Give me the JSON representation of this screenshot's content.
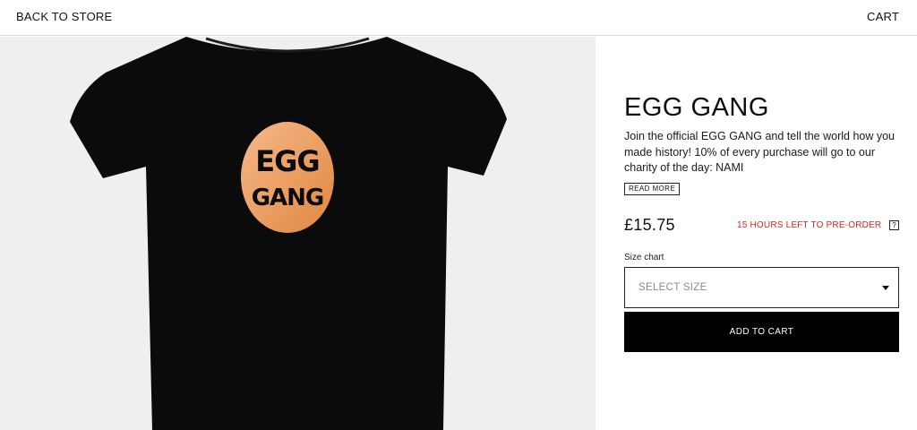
{
  "nav": {
    "back_label": "BACK TO STORE",
    "cart_label": "CART"
  },
  "product": {
    "title": "EGG GANG",
    "description": "Join the official EGG GANG and tell the world how you made history! 10% of every purchase will go to our charity of the day: NAMI",
    "read_more_label": "READ MORE",
    "price": "£15.75",
    "preorder_text": "15 HOURS LEFT TO PRE-ORDER",
    "help_label": "?",
    "size_chart_label": "Size chart",
    "size_select_value": "SELECT SIZE",
    "add_to_cart_label": "ADD TO CART",
    "image": {
      "logo_line1": "EGG",
      "logo_line2": "GANG",
      "shirt_color": "#0b0b0b",
      "logo_color_start": "#f6b98a",
      "logo_color_end": "#e0873f"
    }
  },
  "colors": {
    "preorder": "#e0231e",
    "button_bg": "#000000",
    "gallery_bg": "#efefef"
  }
}
